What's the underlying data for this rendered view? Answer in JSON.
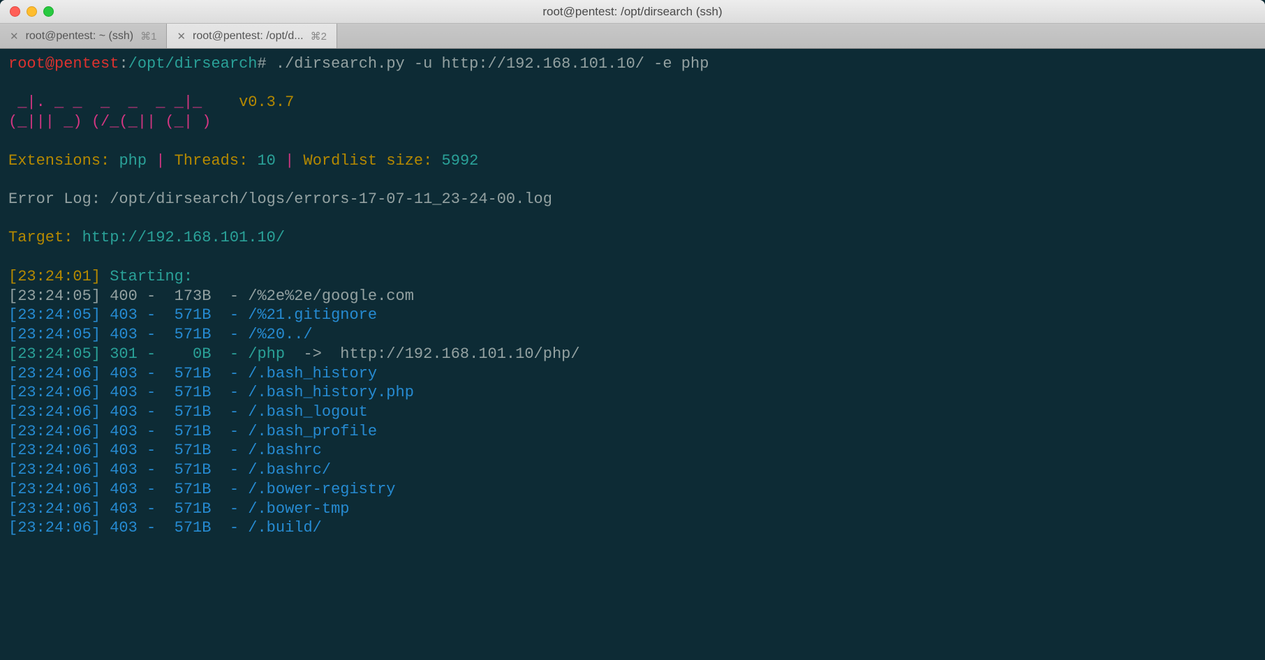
{
  "window": {
    "title": "root@pentest: /opt/dirsearch (ssh)"
  },
  "tabs": [
    {
      "label": "root@pentest: ~ (ssh)",
      "shortcut": "⌘1",
      "active": false
    },
    {
      "label": "root@pentest: /opt/d...",
      "shortcut": "⌘2",
      "active": true
    }
  ],
  "prompt": {
    "user_host": "root@pentest",
    "colon": ":",
    "path": "/opt/dirsearch",
    "symbol": "#",
    "command": "./dirsearch.py -u http://192.168.101.10/ -e php"
  },
  "banner": {
    "line1": " _|. _ _  _  _  _ _|_",
    "line2": "(_||| _) (/_(_|| (_| )",
    "version": "v0.3.7"
  },
  "config": {
    "ext_label": "Extensions:",
    "ext_value": "php",
    "sep": "|",
    "threads_label": "Threads:",
    "threads_value": "10",
    "wordlist_label": "Wordlist size:",
    "wordlist_value": "5992"
  },
  "errorlog": {
    "label": "Error Log:",
    "path": "/opt/dirsearch/logs/errors-17-07-11_23-24-00.log"
  },
  "target": {
    "label": "Target:",
    "url": "http://192.168.101.10/"
  },
  "start": {
    "time": "[23:24:01]",
    "text": "Starting:"
  },
  "rows": [
    {
      "time": "[23:24:05]",
      "status": "400",
      "size": "173B",
      "path": "/%2e%2e/google.com",
      "redir": "",
      "cls": "c-grey"
    },
    {
      "time": "[23:24:05]",
      "status": "403",
      "size": "571B",
      "path": "/%21.gitignore",
      "redir": "",
      "cls": "c-blue"
    },
    {
      "time": "[23:24:05]",
      "status": "403",
      "size": "571B",
      "path": "/%20../",
      "redir": "",
      "cls": "c-blue"
    },
    {
      "time": "[23:24:05]",
      "status": "301",
      "size": "0B",
      "path": "/php",
      "redir": "  ->  http://192.168.101.10/php/",
      "cls": "c-cyan"
    },
    {
      "time": "[23:24:06]",
      "status": "403",
      "size": "571B",
      "path": "/.bash_history",
      "redir": "",
      "cls": "c-blue"
    },
    {
      "time": "[23:24:06]",
      "status": "403",
      "size": "571B",
      "path": "/.bash_history.php",
      "redir": "",
      "cls": "c-blue"
    },
    {
      "time": "[23:24:06]",
      "status": "403",
      "size": "571B",
      "path": "/.bash_logout",
      "redir": "",
      "cls": "c-blue"
    },
    {
      "time": "[23:24:06]",
      "status": "403",
      "size": "571B",
      "path": "/.bash_profile",
      "redir": "",
      "cls": "c-blue"
    },
    {
      "time": "[23:24:06]",
      "status": "403",
      "size": "571B",
      "path": "/.bashrc",
      "redir": "",
      "cls": "c-blue"
    },
    {
      "time": "[23:24:06]",
      "status": "403",
      "size": "571B",
      "path": "/.bashrc/",
      "redir": "",
      "cls": "c-blue"
    },
    {
      "time": "[23:24:06]",
      "status": "403",
      "size": "571B",
      "path": "/.bower-registry",
      "redir": "",
      "cls": "c-blue"
    },
    {
      "time": "[23:24:06]",
      "status": "403",
      "size": "571B",
      "path": "/.bower-tmp",
      "redir": "",
      "cls": "c-blue"
    },
    {
      "time": "[23:24:06]",
      "status": "403",
      "size": "571B",
      "path": "/.build/",
      "redir": "",
      "cls": "c-blue"
    }
  ]
}
